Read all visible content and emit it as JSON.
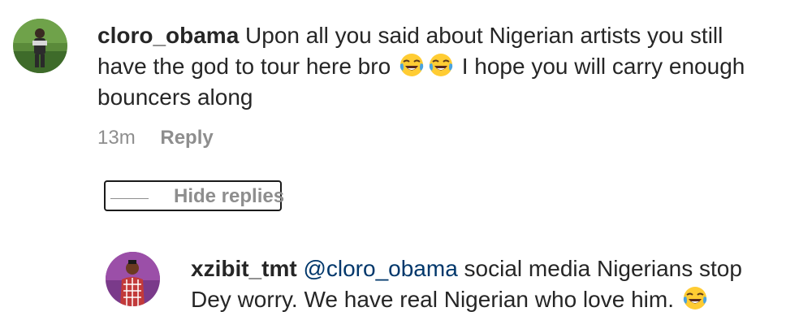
{
  "comment": {
    "username": "cloro_obama",
    "text_part1": " Upon all you said about Nigerian artists you still have the god to tour here bro ",
    "emoji_1": "face-with-tears-of-joy-icon",
    "emoji_2": "face-with-tears-of-joy-icon",
    "text_part2": " I hope you will carry enough bouncers along",
    "time": "13m",
    "reply_label": "Reply"
  },
  "replies_toggle": {
    "label": "Hide replies"
  },
  "reply": {
    "username": "xzibit_tmt",
    "mention": "@cloro_obama",
    "text": " social media Nigerians stop Dey worry. We have real Nigerian who love him. ",
    "emoji": "face-with-tears-of-joy-icon"
  },
  "colors": {
    "text": "#262626",
    "secondary": "#8e8e8e",
    "mention": "#00376b",
    "emoji_face": "#ffcc33",
    "emoji_tears": "#4aa3df"
  }
}
